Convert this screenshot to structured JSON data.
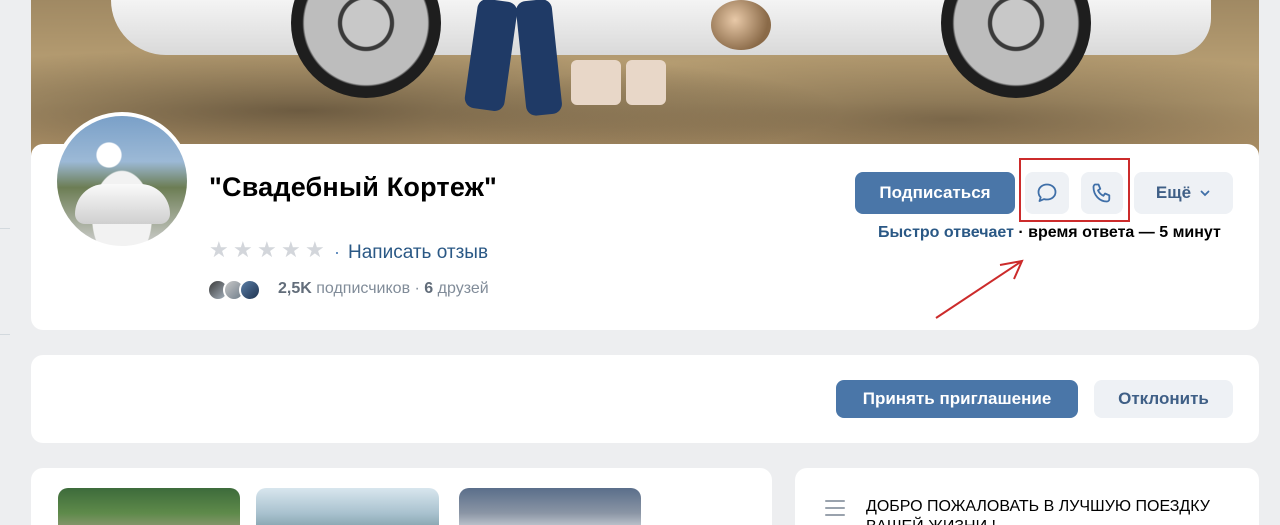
{
  "cover": {
    "description_icon": "cover-photo"
  },
  "profile": {
    "title": "\"Свадебный Кортеж\"",
    "rating_stars": 0,
    "rating_max": 5,
    "review_sep": "·",
    "review_link": "Написать отзыв",
    "subscribers_count": "2,5K",
    "subscribers_label": "подписчиков ·",
    "friends_count": "6",
    "friends_label": "друзей"
  },
  "actions": {
    "subscribe": "Подписаться",
    "more": "Ещё",
    "message_icon": "chat-bubble-icon",
    "call_icon": "phone-icon",
    "more_icon": "chevron-down-icon"
  },
  "response": {
    "fast": "Быстро отвечает",
    "sep": " · ",
    "time": "время ответа — 5 минут"
  },
  "invite": {
    "accept": "Принять приглашение",
    "decline": "Отклонить"
  },
  "info": {
    "welcome": "ДОБРО ПОЖАЛОВАТЬ В ЛУЧШУЮ ПОЕЗДКУ ВАШЕЙ ЖИЗНИ !"
  },
  "colors": {
    "accent": "#4a76a8",
    "link": "#2a5885",
    "highlight": "#cc2b2b",
    "background": "#edeef0"
  }
}
